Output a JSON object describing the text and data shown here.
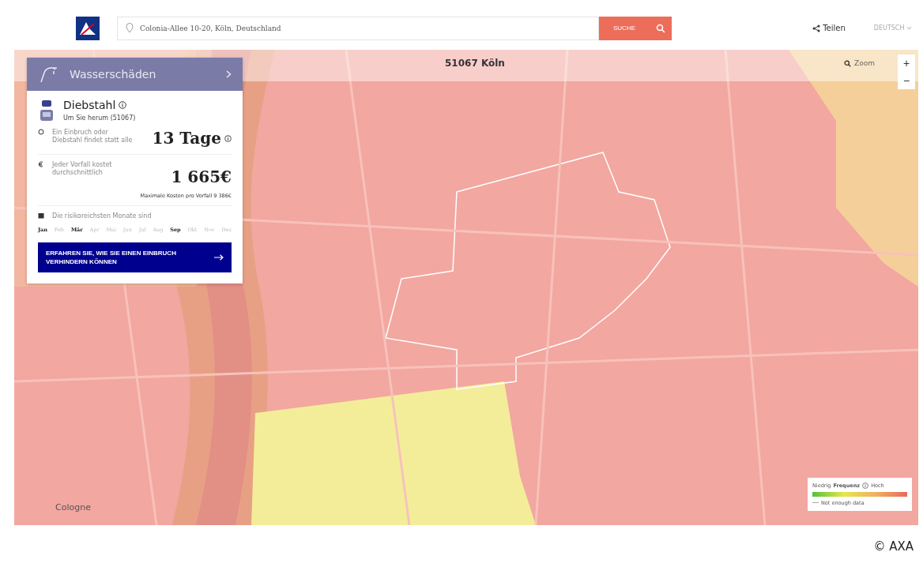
{
  "header": {
    "search": {
      "value": "Colonia-Allee 10-20, Köln, Deutschland"
    },
    "search_button": "SUCHE",
    "share": "Teilen",
    "language": "DEUTSCH"
  },
  "map": {
    "title": "51067 Köln",
    "zoom": "Zoom",
    "zoom_in": "+",
    "zoom_out": "−",
    "place_label": "Cologne"
  },
  "panel": {
    "category": "Wasserschäden",
    "risk": {
      "title": "Diebstahl",
      "location": "Um Sie herum (51067)"
    },
    "frequency": {
      "label": "Ein Einbruch oder Diebstahl findet statt alle",
      "value": "13 Tage"
    },
    "cost": {
      "label": "Jeder Vorfall kostet durchschnittlich",
      "value": "1 665€",
      "max": "Maximale Kosten pro Vorfall 9 386€"
    },
    "months_label": "Die risikoreichsten Monate sind",
    "months": [
      {
        "label": "Jan",
        "selected": true
      },
      {
        "label": "Feb",
        "selected": false
      },
      {
        "label": "Mär",
        "selected": true
      },
      {
        "label": "Apr",
        "selected": false
      },
      {
        "label": "Mai",
        "selected": false
      },
      {
        "label": "Jun",
        "selected": false
      },
      {
        "label": "Jul",
        "selected": false
      },
      {
        "label": "Aug",
        "selected": false
      },
      {
        "label": "Sep",
        "selected": true
      },
      {
        "label": "Okt",
        "selected": false
      },
      {
        "label": "Nov",
        "selected": false
      },
      {
        "label": "Dez",
        "selected": false
      }
    ],
    "cta": "ERFAHREN SIE, WIE SIE EINEN EINBRUCH VERHINDERN KÖNNEN"
  },
  "legend": {
    "low": "Niedrig",
    "title": "Frequenz",
    "high": "Hoch",
    "no_data": "Not enough data"
  },
  "credit": "© AXA"
}
